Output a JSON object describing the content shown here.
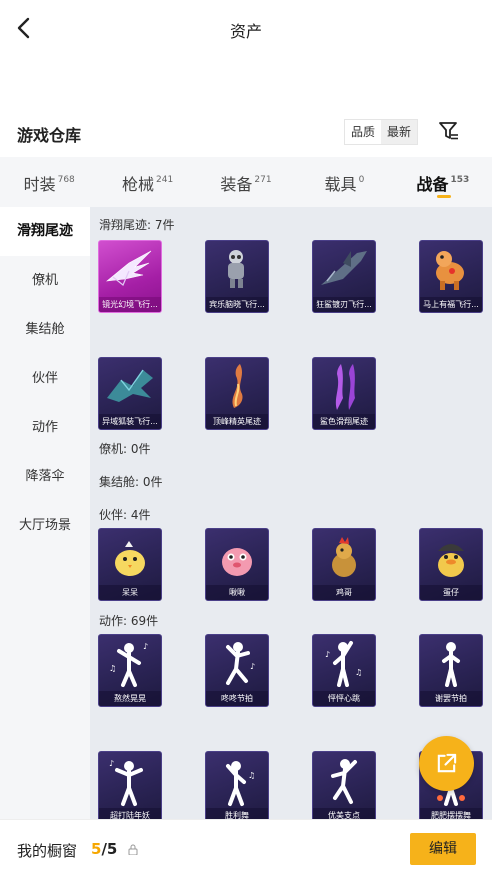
{
  "header": {
    "title": "资产"
  },
  "warehouse": {
    "title": "游戏仓库",
    "sort_options": [
      "品质",
      "最新"
    ],
    "sort_active": "最新"
  },
  "tabs": [
    {
      "label": "时装",
      "count": "768"
    },
    {
      "label": "枪械",
      "count": "241"
    },
    {
      "label": "装备",
      "count": "271"
    },
    {
      "label": "载具",
      "count": "0"
    },
    {
      "label": "战备",
      "count": "153",
      "active": true
    }
  ],
  "side_nav": [
    "滑翔尾迹",
    "僚机",
    "集结舱",
    "伙伴",
    "动作",
    "降落伞",
    "大厅场景"
  ],
  "sections": {
    "trail": {
      "heading": "滑翔尾迹: 7件",
      "items": [
        "镜光幻境飞行...",
        "宾乐脑晓飞行...",
        "狂鲨镀刃飞行...",
        "马上有福飞行...",
        "异域狐装飞行...",
        "顶峰精英尾迹",
        "鲨色滑翔尾迹"
      ]
    },
    "drone": {
      "heading": "僚机: 0件"
    },
    "pod": {
      "heading": "集结舱: 0件"
    },
    "partner": {
      "heading": "伙伴: 4件",
      "items": [
        "呆呆",
        "啾啾",
        "鸡哥",
        "蛋仔"
      ]
    },
    "emote": {
      "heading": "动作: 69件",
      "items": [
        "熬然晃晃",
        "咚咚节拍",
        "怦怦心跳",
        "谢罢节拍",
        "超打陆年妖",
        "胜利舞",
        "优美支点",
        "肥肥摆摆舞"
      ]
    }
  },
  "bottom": {
    "showcase_label": "我的橱窗",
    "current": "5",
    "total": "/5",
    "lock_glyph": "🔒",
    "edit_label": "编辑"
  },
  "colors": {
    "accent": "#f6b21a",
    "card_bg": "#2a2354",
    "card_selected": "#a51fa6"
  }
}
